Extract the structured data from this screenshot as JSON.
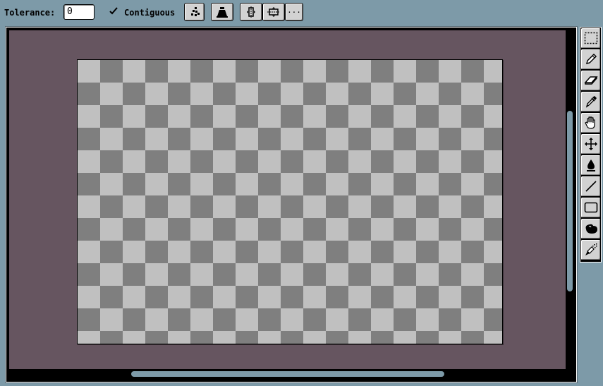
{
  "toolbar": {
    "tolerance_label": "Tolerance:",
    "tolerance_value": "0",
    "contiguous_label": "Contiguous",
    "contiguous_checked": true,
    "more_label": "..."
  },
  "canvas": {
    "checker_dark": "#7f7f7f",
    "checker_light": "#c0c0c0",
    "workspace_color": "#665560"
  },
  "tools": [
    {
      "name": "select-rectangle",
      "icon": "marquee-icon"
    },
    {
      "name": "pencil",
      "icon": "pencil-icon"
    },
    {
      "name": "eraser",
      "icon": "eraser-icon"
    },
    {
      "name": "eyedropper",
      "icon": "eyedropper-icon"
    },
    {
      "name": "hand",
      "icon": "hand-icon"
    },
    {
      "name": "move",
      "icon": "move-icon"
    },
    {
      "name": "fill",
      "icon": "ink-drop-icon"
    },
    {
      "name": "line",
      "icon": "line-icon"
    },
    {
      "name": "rectangle",
      "icon": "rectangle-icon"
    },
    {
      "name": "blob",
      "icon": "blob-icon"
    },
    {
      "name": "spray",
      "icon": "spray-icon"
    }
  ]
}
